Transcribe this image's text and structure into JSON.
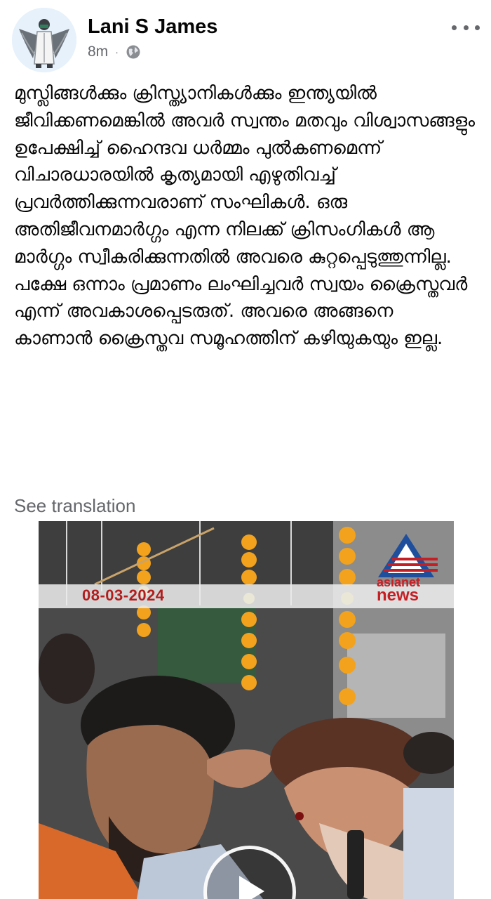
{
  "post": {
    "author": "Lani S James",
    "time": "8m",
    "separator": "·",
    "privacy_icon": "globe-icon",
    "text": "മുസ്ലിങ്ങൾക്കും ക്രിസ്ത്യാനികൾക്കും ഇന്ത്യയിൽ ജീവിക്കണമെങ്കിൽ അവർ സ്വന്തം മതവും വിശ്വാസങ്ങളും ഉപേക്ഷിച്ച് ഹൈന്ദവ ധർമ്മം പുൽകണമെന്ന് വിചാരധാരയിൽ കൃത്യമായി എഴുതിവച്ച് പ്രവർത്തിക്കുന്നവരാണ് സംഘികൾ. ഒരു അതിജീവനമാർഗ്ഗം എന്ന നിലക്ക് ക്രിസംഗികൾ ആ മാർഗ്ഗം സ്വീകരിക്കുന്നതിൽ അവരെ കുറ്റപ്പെടുത്തുന്നില്ല. പക്ഷേ ഒന്നാം പ്രമാണം ലംഘിച്ചവർ സ്വയം ക്രൈസ്തവർ എന്ന് അവകാശപ്പെടരുത്. അവരെ അങ്ങനെ കാണാൻ ക്രൈസ്തവ സമൂഹത്തിന് കഴിയുകയും ഇല്ല.",
    "see_translation": "See translation"
  },
  "media": {
    "date": "08-03-2024",
    "logo_line1": "asianet",
    "logo_line2": "news",
    "play_icon": "play-icon"
  },
  "colors": {
    "name": "#050505",
    "meta": "#65676b",
    "date": "#b21e1e",
    "logo": "#c51f24",
    "avatar_bg": "#e6f1fb"
  }
}
